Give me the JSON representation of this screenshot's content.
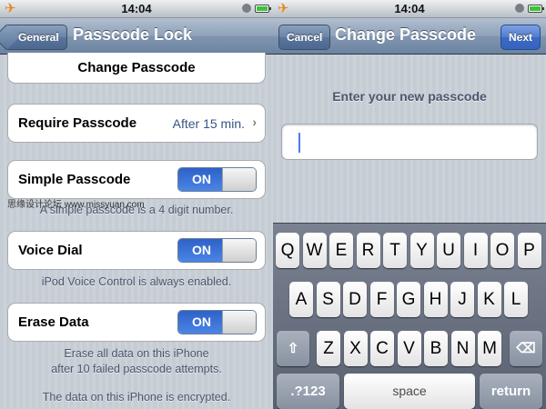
{
  "status_bar": {
    "time": "14:04",
    "airplane_glyph": "✈",
    "icons": [
      "airplane-mode-icon",
      "lock-icon",
      "battery-icon"
    ]
  },
  "left": {
    "nav": {
      "back_label": "General",
      "title": "Passcode Lock"
    },
    "change_passcode_label": "Change Passcode",
    "require_passcode": {
      "label": "Require Passcode",
      "value": "After 15 min.",
      "chevron": "›"
    },
    "simple_passcode": {
      "label": "Simple Passcode",
      "toggle": "ON",
      "note": "A simple passcode is a 4 digit number."
    },
    "voice_dial": {
      "label": "Voice Dial",
      "toggle": "ON",
      "note": "iPod Voice Control is always enabled."
    },
    "erase_data": {
      "label": "Erase Data",
      "toggle": "ON",
      "note_line1": "Erase all data on this iPhone",
      "note_line2": "after 10 failed passcode attempts."
    },
    "encrypted_note": "The data on this iPhone is encrypted.",
    "watermark": "思缘设计论坛 www.missyuan.com"
  },
  "right": {
    "nav": {
      "cancel_label": "Cancel",
      "title": "Change Passcode",
      "next_label": "Next"
    },
    "prompt": "Enter your new passcode",
    "keyboard": {
      "row1": [
        "Q",
        "W",
        "E",
        "R",
        "T",
        "Y",
        "U",
        "I",
        "O",
        "P"
      ],
      "row2": [
        "A",
        "S",
        "D",
        "F",
        "G",
        "H",
        "J",
        "K",
        "L"
      ],
      "row3": [
        "Z",
        "X",
        "C",
        "V",
        "B",
        "N",
        "M"
      ],
      "shift_glyph": "⇧",
      "delete_glyph": "⌫",
      "numbers_label": ".?123",
      "space_label": "space",
      "return_label": "return"
    }
  },
  "colors": {
    "toggle_on": "#2e61c7",
    "value_text": "#385487",
    "nav_blue": "#3b6ac6"
  }
}
